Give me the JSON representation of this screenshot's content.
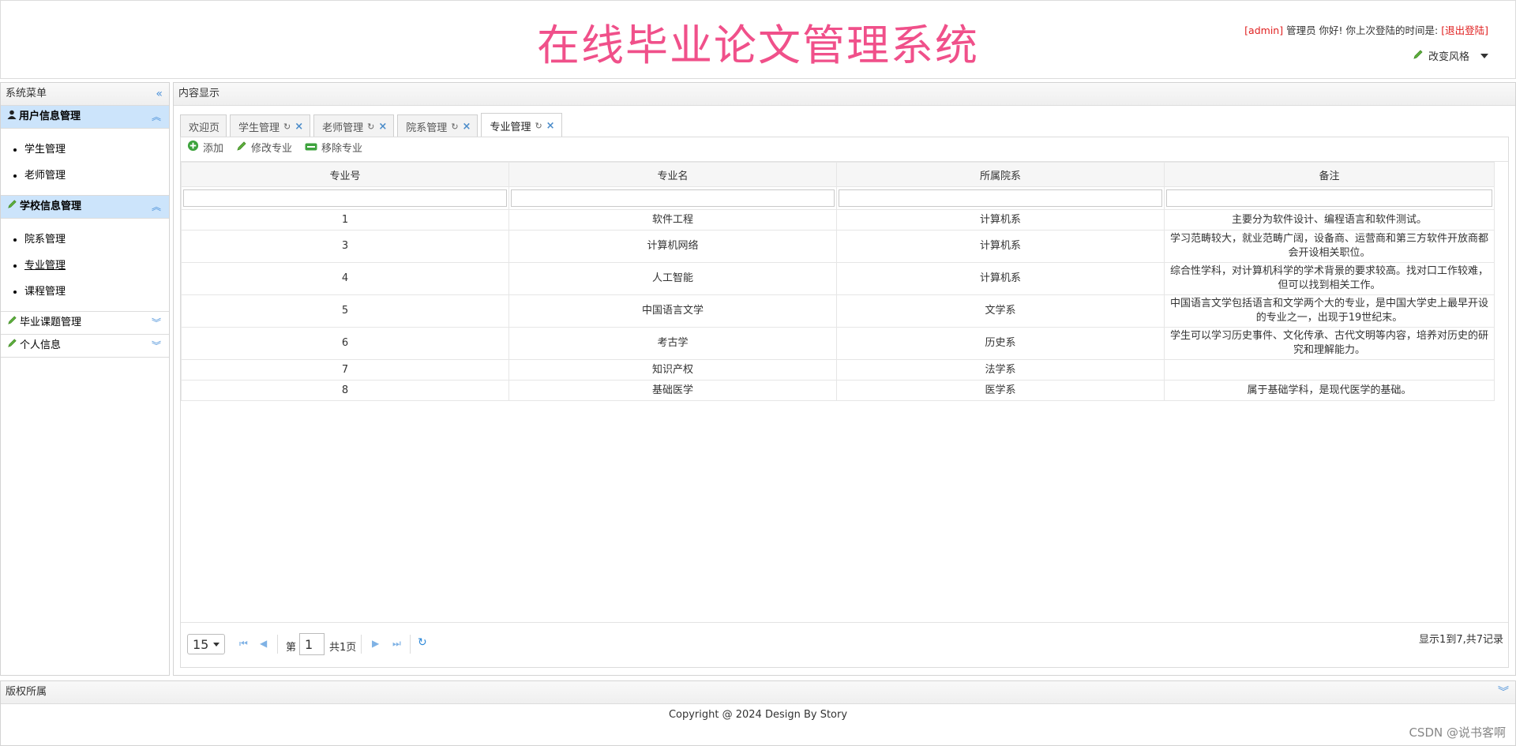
{
  "header": {
    "title": "在线毕业论文管理系统",
    "user_tag": "[admin]",
    "greeting": "管理员 你好! 你上次登陆的时间是:",
    "logout": "[退出登陆]",
    "style_switch": "改变风格"
  },
  "sidebar": {
    "title": "系统菜单",
    "groups": [
      {
        "label": "用户信息管理",
        "open": true,
        "items": [
          "学生管理",
          "老师管理"
        ]
      },
      {
        "label": "学校信息管理",
        "open": true,
        "items": [
          "院系管理",
          "专业管理",
          "课程管理"
        ]
      },
      {
        "label": "毕业课题管理",
        "open": false,
        "items": []
      },
      {
        "label": "个人信息",
        "open": false,
        "items": []
      }
    ]
  },
  "center": {
    "title": "内容显示",
    "tabs": [
      "欢迎页",
      "学生管理",
      "老师管理",
      "院系管理",
      "专业管理"
    ],
    "toolbar": {
      "add": "添加",
      "edit": "修改专业",
      "remove": "移除专业"
    },
    "columns": [
      "专业号",
      "专业名",
      "所属院系",
      "备注"
    ],
    "rows": [
      [
        "1",
        "软件工程",
        "计算机系",
        "主要分为软件设计、编程语言和软件测试。"
      ],
      [
        "3",
        "计算机网络",
        "计算机系",
        "学习范畴较大，就业范畴广阔，设备商、运营商和第三方软件开放商都会开设相关职位。"
      ],
      [
        "4",
        "人工智能",
        "计算机系",
        "综合性学科，对计算机科学的学术背景的要求较高。找对口工作较难，但可以找到相关工作。"
      ],
      [
        "5",
        "中国语言文学",
        "文学系",
        "中国语言文学包括语言和文学两个大的专业，是中国大学史上最早开设的专业之一，出现于19世纪末。"
      ],
      [
        "6",
        "考古学",
        "历史系",
        "学生可以学习历史事件、文化传承、古代文明等内容，培养对历史的研究和理解能力。"
      ],
      [
        "7",
        "知识产权",
        "法学系",
        ""
      ],
      [
        "8",
        "基础医学",
        "医学系",
        "属于基础学科，是现代医学的基础。"
      ]
    ],
    "pager": {
      "page_size": "15",
      "page_prefix": "第",
      "page_number": "1",
      "page_total": "共1页",
      "info": "显示1到7,共7记录"
    }
  },
  "footer": {
    "title": "版权所属",
    "copyright": "Copyright @ 2024 Design By Story",
    "watermark": "CSDN @说书客啊"
  },
  "colors": {
    "title": "#f0508a",
    "accent": "#4a90d9",
    "active_group": "#cce4fb",
    "alert": "#e02020"
  }
}
